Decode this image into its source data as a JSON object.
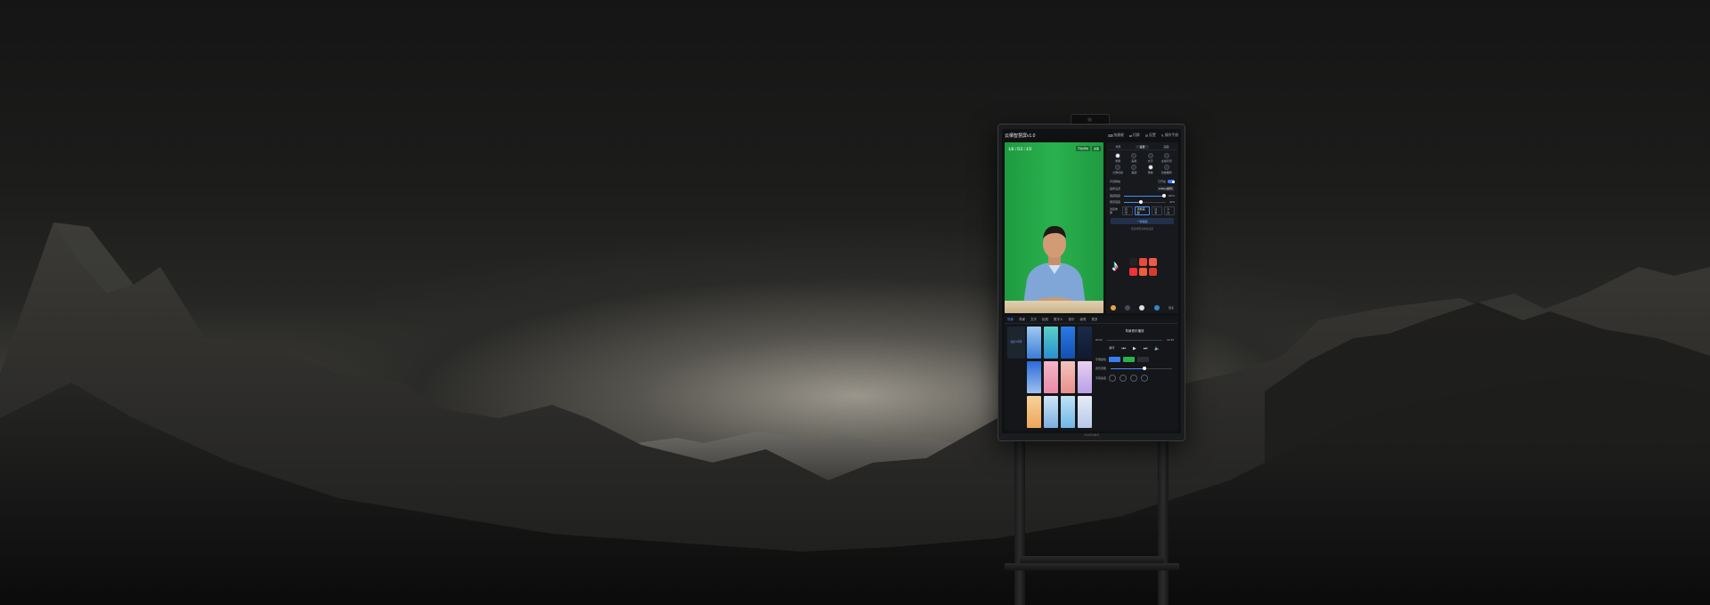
{
  "app": {
    "title": "云栖智慧屏v1.0",
    "toolbar": [
      {
        "label": "快捷键",
        "icon": "keyboard-icon"
      },
      {
        "label": "切换",
        "icon": "switch-icon"
      },
      {
        "label": "设置",
        "icon": "gear-icon"
      },
      {
        "label": "操作手册",
        "icon": "book-icon"
      }
    ]
  },
  "video": {
    "clock": "16:52:15",
    "tags": [
      "开始录制",
      "画面"
    ]
  },
  "panel": {
    "tabs": [
      "场景",
      "设置",
      "画面"
    ],
    "active_tab": "设置",
    "icons": [
      {
        "label": "录屏",
        "icon": "record-icon"
      },
      {
        "label": "画笔",
        "icon": "pen-icon"
      },
      {
        "label": "文字",
        "icon": "text-icon"
      },
      {
        "label": "虚拟背景",
        "icon": "background-icon"
      },
      {
        "label": "分屏切换",
        "icon": "split-icon"
      },
      {
        "label": "美颜",
        "icon": "beauty-icon"
      },
      {
        "label": "录制",
        "icon": "camera-icon"
      },
      {
        "label": "镜像翻转",
        "icon": "mirror-icon"
      }
    ],
    "ai_label": "声音降噪",
    "ai_status": "已开启",
    "resolution_label": "画质设置",
    "resolution_value": "1080p(推荐)",
    "sliders": [
      {
        "label": "美颜强度",
        "value": 100,
        "display": "100%"
      },
      {
        "label": "磨皮强度",
        "value": 40,
        "display": "40%"
      }
    ],
    "filter_label": "滤镜效果",
    "filters": [
      "自然",
      "清新亮丽",
      "白皙",
      "冷淡"
    ],
    "primary_button": "一键美颜",
    "hint": "更多效果请前往设置",
    "more_label": "更多"
  },
  "lower": {
    "tabs": [
      "场景",
      "背景",
      "文字",
      "贴纸",
      "数字人",
      "音乐",
      "画笔",
      "更多"
    ],
    "active_tab": "场景",
    "side_label": "自定义背景",
    "player_title": "背景音乐播放",
    "time_start": "00:00",
    "time_end": "03:45",
    "loop_label": "循环",
    "color_label": "字幕颜色",
    "volume_label": "音乐音量",
    "volume": 55,
    "speed_label": "字幕速度"
  },
  "monitor": {
    "brand": "HUGHAO"
  },
  "colors": {
    "chroma_green": "#27a84b",
    "accent_blue": "#4a8cff",
    "panel_bg": "#17191d",
    "tiktok_cyan": "#25f4ee",
    "tiktok_red": "#fe2c55"
  }
}
